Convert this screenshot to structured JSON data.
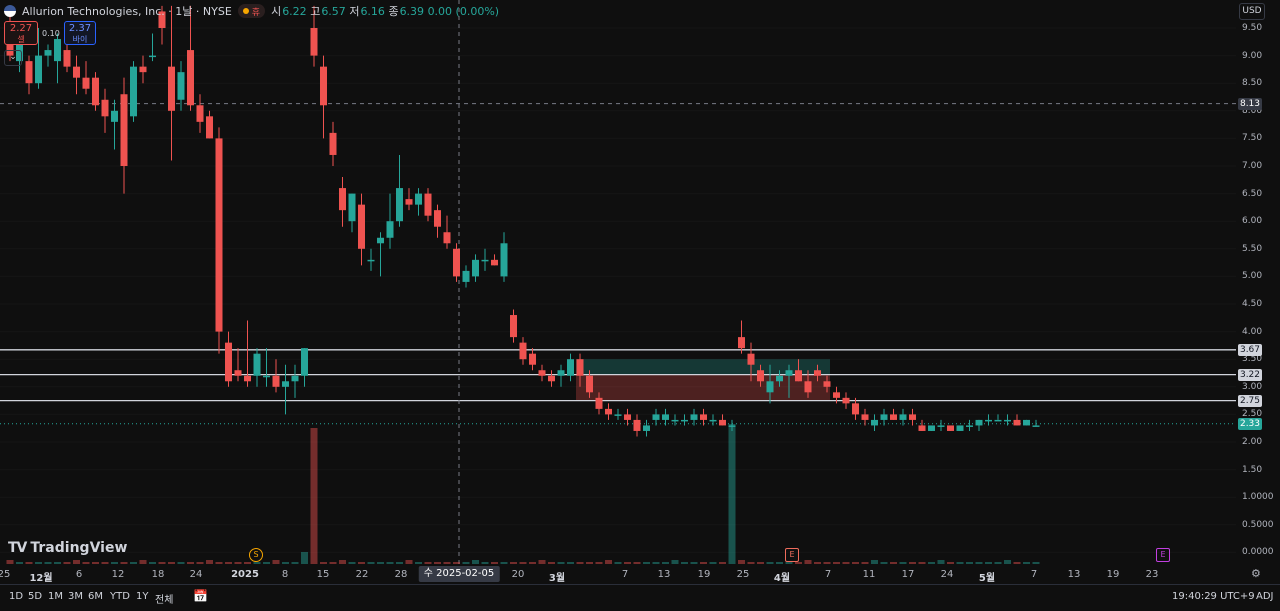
{
  "legend": {
    "title": "Allurion Technologies, Inc. · 1날 · NYSE",
    "status_mark": "휴",
    "ohlc": [
      {
        "k": "시",
        "v": "6.22"
      },
      {
        "k": "고",
        "v": "6.57"
      },
      {
        "k": "저",
        "v": "6.16"
      },
      {
        "k": "종",
        "v": "6.39"
      }
    ],
    "change": "0.00 (0.00%)"
  },
  "trade": {
    "sell_price": "2.27",
    "sell_label": "셀",
    "spread": "0.10",
    "buy_price": "2.37",
    "buy_label": "바이"
  },
  "currency": "USD",
  "price_ticks": [
    "9.50",
    "9.00",
    "8.50",
    "8.00",
    "7.50",
    "7.00",
    "6.50",
    "6.00",
    "5.50",
    "5.00",
    "4.50",
    "4.00",
    "3.50",
    "3.00",
    "2.50",
    "2.00",
    "1.50",
    "1.0000",
    "0.5000",
    "0.0000"
  ],
  "price_labels": {
    "crosshair": "8.13",
    "line1": "3.67",
    "line2": "3.22",
    "line3": "2.75",
    "last": "2.33"
  },
  "time_labels": [
    "25",
    "12월",
    "6",
    "12",
    "18",
    "24",
    "2025",
    "8",
    "15",
    "22",
    "28",
    "6",
    "13",
    "20",
    "3월",
    "7",
    "13",
    "19",
    "25",
    "4월",
    "7",
    "11",
    "17",
    "24",
    "5월",
    "7",
    "13",
    "19",
    "23"
  ],
  "crosshair_time": "수 2025-02-05",
  "events": {
    "split": "S",
    "earnings1": "E",
    "earnings2": "E"
  },
  "branding": "TradingView",
  "toolbar": {
    "ranges": [
      "1D",
      "5D",
      "1M",
      "3M",
      "6M",
      "YTD",
      "1Y",
      "전체"
    ],
    "clock": "19:40:29 UTC+9",
    "adj": "ADJ"
  },
  "colors": {
    "up": "#26a69a",
    "down": "#ef5350",
    "background": "#0f0f0f"
  },
  "chart_data": {
    "type": "candlestick",
    "y_unit": "USD",
    "horizontal_levels": [
      3.67,
      3.22,
      2.75
    ],
    "crosshair_price": 8.13,
    "last_price": 2.33,
    "candles": [
      [
        9.6,
        9.9,
        8.9,
        9.0
      ],
      [
        8.9,
        9.5,
        8.7,
        9.3
      ],
      [
        8.9,
        9.0,
        8.3,
        8.5
      ],
      [
        8.5,
        9.5,
        8.4,
        9.0
      ],
      [
        9.0,
        9.2,
        8.8,
        9.1
      ],
      [
        8.9,
        9.4,
        8.5,
        9.3
      ],
      [
        9.1,
        9.3,
        8.7,
        8.8
      ],
      [
        8.8,
        9.0,
        8.3,
        8.6
      ],
      [
        8.6,
        8.9,
        8.3,
        8.4
      ],
      [
        8.6,
        8.7,
        8.0,
        8.1
      ],
      [
        8.2,
        8.4,
        7.6,
        7.9
      ],
      [
        7.8,
        8.2,
        7.3,
        8.0
      ],
      [
        8.3,
        8.6,
        6.5,
        7.0
      ],
      [
        7.9,
        8.9,
        7.8,
        8.8
      ],
      [
        8.8,
        9.0,
        8.5,
        8.7
      ],
      [
        9.0,
        9.4,
        8.9,
        9.0
      ],
      [
        9.8,
        9.9,
        9.2,
        9.5
      ],
      [
        8.8,
        9.9,
        7.1,
        8.0
      ],
      [
        8.2,
        8.9,
        8.0,
        8.7
      ],
      [
        9.1,
        9.9,
        8.0,
        8.1
      ],
      [
        8.1,
        8.3,
        7.6,
        7.8
      ],
      [
        7.9,
        8.0,
        7.5,
        7.5
      ],
      [
        7.5,
        7.7,
        3.6,
        4.0
      ],
      [
        3.8,
        4.0,
        3.0,
        3.1
      ],
      [
        3.3,
        3.7,
        3.1,
        3.2
      ],
      [
        3.2,
        4.2,
        3.0,
        3.1
      ],
      [
        3.2,
        3.7,
        3.0,
        3.6
      ],
      [
        3.2,
        3.7,
        3.0,
        3.2
      ],
      [
        3.2,
        3.5,
        2.9,
        3.0
      ],
      [
        3.0,
        3.4,
        2.5,
        3.1
      ],
      [
        3.1,
        3.4,
        2.8,
        3.2
      ],
      [
        3.2,
        3.7,
        3.0,
        3.7
      ],
      [
        9.5,
        9.9,
        8.8,
        9.0
      ],
      [
        8.8,
        9.0,
        7.5,
        8.1
      ],
      [
        7.6,
        7.8,
        7.0,
        7.2
      ],
      [
        6.6,
        6.8,
        5.9,
        6.2
      ],
      [
        6.0,
        6.5,
        5.8,
        6.5
      ],
      [
        6.3,
        6.5,
        5.2,
        5.5
      ],
      [
        5.3,
        5.5,
        5.1,
        5.3
      ],
      [
        5.6,
        5.8,
        5.0,
        5.7
      ],
      [
        5.7,
        6.5,
        5.5,
        6.0
      ],
      [
        6.0,
        7.2,
        5.9,
        6.6
      ],
      [
        6.4,
        6.6,
        6.2,
        6.3
      ],
      [
        6.3,
        6.6,
        6.1,
        6.5
      ],
      [
        6.5,
        6.6,
        6.0,
        6.1
      ],
      [
        6.2,
        6.3,
        5.7,
        5.9
      ],
      [
        5.8,
        6.1,
        5.5,
        5.6
      ],
      [
        5.5,
        5.6,
        4.9,
        5.0
      ],
      [
        4.9,
        5.2,
        4.8,
        5.1
      ],
      [
        5.0,
        5.4,
        4.9,
        5.3
      ],
      [
        5.3,
        5.5,
        5.1,
        5.3
      ],
      [
        5.3,
        5.4,
        5.2,
        5.2
      ],
      [
        5.0,
        5.8,
        4.9,
        5.6
      ],
      [
        4.3,
        4.4,
        3.8,
        3.9
      ],
      [
        3.8,
        3.9,
        3.4,
        3.5
      ],
      [
        3.6,
        3.7,
        3.3,
        3.4
      ],
      [
        3.3,
        3.4,
        3.1,
        3.2
      ],
      [
        3.2,
        3.3,
        3.0,
        3.1
      ],
      [
        3.2,
        3.4,
        3.0,
        3.3
      ],
      [
        3.2,
        3.6,
        3.1,
        3.5
      ],
      [
        3.5,
        3.6,
        3.0,
        3.2
      ],
      [
        3.2,
        3.3,
        2.8,
        2.9
      ],
      [
        2.8,
        2.9,
        2.5,
        2.6
      ],
      [
        2.6,
        2.7,
        2.4,
        2.5
      ],
      [
        2.5,
        2.6,
        2.4,
        2.5
      ],
      [
        2.5,
        2.6,
        2.3,
        2.4
      ],
      [
        2.4,
        2.5,
        2.1,
        2.2
      ],
      [
        2.2,
        2.4,
        2.1,
        2.3
      ],
      [
        2.4,
        2.6,
        2.3,
        2.5
      ],
      [
        2.4,
        2.6,
        2.3,
        2.5
      ],
      [
        2.4,
        2.5,
        2.3,
        2.4
      ],
      [
        2.4,
        2.5,
        2.3,
        2.4
      ],
      [
        2.4,
        2.6,
        2.3,
        2.5
      ],
      [
        2.5,
        2.6,
        2.3,
        2.4
      ],
      [
        2.4,
        2.5,
        2.3,
        2.4
      ],
      [
        2.4,
        2.5,
        2.3,
        2.3
      ],
      [
        2.3,
        2.4,
        2.2,
        2.3
      ],
      [
        3.9,
        4.2,
        3.6,
        3.7
      ],
      [
        3.6,
        3.8,
        3.1,
        3.4
      ],
      [
        3.3,
        3.4,
        3.0,
        3.1
      ],
      [
        2.9,
        3.4,
        2.7,
        3.1
      ],
      [
        3.1,
        3.3,
        3.0,
        3.2
      ],
      [
        3.2,
        3.4,
        2.8,
        3.3
      ],
      [
        3.3,
        3.5,
        3.1,
        3.1
      ],
      [
        3.1,
        3.3,
        2.8,
        2.9
      ],
      [
        3.3,
        3.4,
        3.1,
        3.2
      ],
      [
        3.1,
        3.2,
        2.9,
        3.0
      ],
      [
        2.9,
        3.0,
        2.7,
        2.8
      ],
      [
        2.8,
        2.9,
        2.6,
        2.7
      ],
      [
        2.7,
        2.8,
        2.4,
        2.5
      ],
      [
        2.5,
        2.6,
        2.3,
        2.4
      ],
      [
        2.3,
        2.5,
        2.2,
        2.4
      ],
      [
        2.4,
        2.6,
        2.3,
        2.5
      ],
      [
        2.5,
        2.6,
        2.4,
        2.4
      ],
      [
        2.4,
        2.6,
        2.3,
        2.5
      ],
      [
        2.5,
        2.6,
        2.3,
        2.4
      ],
      [
        2.3,
        2.4,
        2.2,
        2.2
      ],
      [
        2.2,
        2.3,
        2.2,
        2.3
      ],
      [
        2.3,
        2.4,
        2.2,
        2.3
      ],
      [
        2.3,
        2.3,
        2.2,
        2.2
      ],
      [
        2.2,
        2.3,
        2.2,
        2.3
      ],
      [
        2.3,
        2.4,
        2.2,
        2.3
      ],
      [
        2.3,
        2.4,
        2.2,
        2.4
      ],
      [
        2.4,
        2.5,
        2.3,
        2.4
      ],
      [
        2.4,
        2.5,
        2.4,
        2.4
      ],
      [
        2.4,
        2.5,
        2.3,
        2.4
      ],
      [
        2.4,
        2.5,
        2.3,
        2.3
      ],
      [
        2.3,
        2.4,
        2.3,
        2.4
      ],
      [
        2.3,
        2.4,
        2.3,
        2.3
      ]
    ]
  }
}
